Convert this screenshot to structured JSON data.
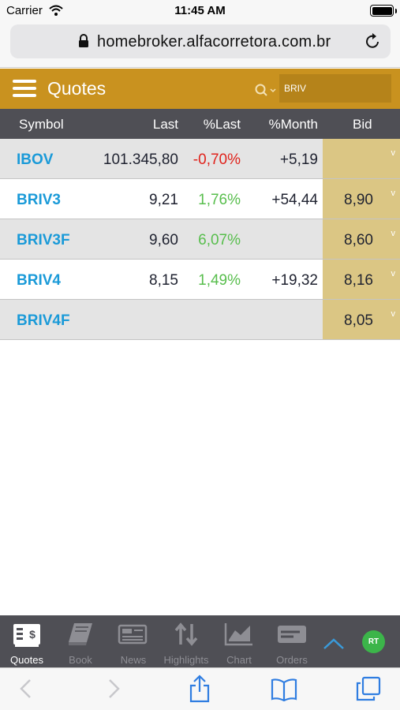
{
  "status_bar": {
    "carrier": "Carrier",
    "time": "11:45 AM"
  },
  "browser": {
    "url": "homebroker.alfacorretora.com.br"
  },
  "header": {
    "title": "Quotes",
    "search_value": "BRIV"
  },
  "columns": {
    "symbol": "Symbol",
    "last": "Last",
    "pct_last": "%Last",
    "pct_month": "%Month",
    "bid": "Bid"
  },
  "rows": [
    {
      "symbol": "IBOV",
      "last": "101.345,80",
      "pct_last": "-0,70%",
      "pct_month": "+5,19",
      "bid": "",
      "chevron": "v"
    },
    {
      "symbol": "BRIV3",
      "last": "9,21",
      "pct_last": "1,76%",
      "pct_month": "+54,44",
      "bid": "8,90",
      "chevron": "v"
    },
    {
      "symbol": "BRIV3F",
      "last": "9,60",
      "pct_last": "6,07%",
      "pct_month": "",
      "bid": "8,60",
      "chevron": "v"
    },
    {
      "symbol": "BRIV4",
      "last": "8,15",
      "pct_last": "1,49%",
      "pct_month": "+19,32",
      "bid": "8,16",
      "chevron": "v"
    },
    {
      "symbol": "BRIV4F",
      "last": "",
      "pct_last": "",
      "pct_month": "",
      "bid": "8,05",
      "chevron": "v"
    }
  ],
  "nav": {
    "items": [
      {
        "label": "Quotes",
        "icon": "quotes-icon",
        "active": true
      },
      {
        "label": "Book",
        "icon": "book-icon",
        "active": false
      },
      {
        "label": "News",
        "icon": "news-icon",
        "active": false
      },
      {
        "label": "Highlights",
        "icon": "highlights-icon",
        "active": false
      },
      {
        "label": "Chart",
        "icon": "chart-icon",
        "active": false
      },
      {
        "label": "Orders",
        "icon": "orders-icon",
        "active": false
      }
    ],
    "rt_badge": "RT"
  },
  "colors": {
    "header_gold": "#c9921f",
    "bid_column": "#dbc684",
    "symbol_blue": "#1a9ad8",
    "negative": "#e0231c",
    "positive": "#58be4d",
    "dark_bar": "#4f4f55",
    "rt_green": "#3cb54a"
  }
}
